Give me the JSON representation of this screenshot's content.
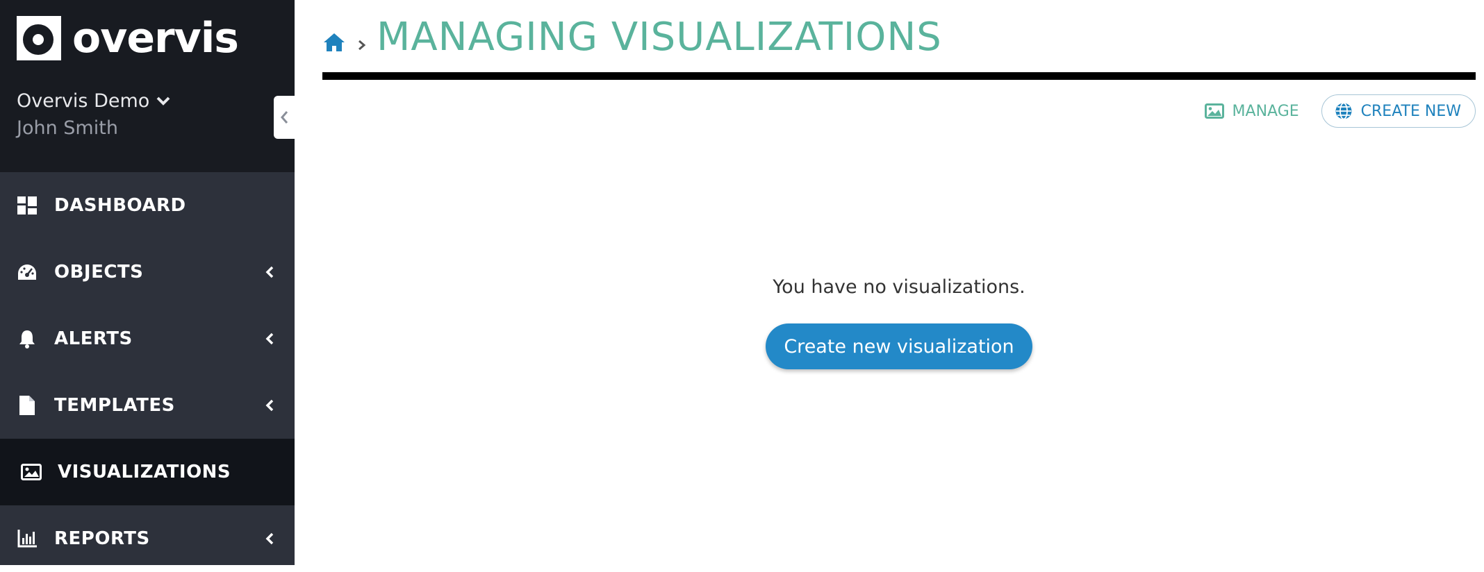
{
  "brand": {
    "name": "overvis"
  },
  "account": {
    "org": "Overvis Demo",
    "user": "John Smith"
  },
  "nav": {
    "items": [
      {
        "label": "DASHBOARD",
        "icon": "dashboard-icon"
      },
      {
        "label": "OBJECTS",
        "icon": "gauge-icon"
      },
      {
        "label": "ALERTS",
        "icon": "bell-icon"
      },
      {
        "label": "TEMPLATES",
        "icon": "file-icon"
      },
      {
        "label": "VISUALIZATIONS",
        "icon": "image-icon",
        "active": true
      },
      {
        "label": "REPORTS",
        "icon": "bar-chart-icon"
      }
    ]
  },
  "page": {
    "title": "MANAGING VISUALIZATIONS"
  },
  "toolbar": {
    "manage_label": "MANAGE",
    "create_label": "CREATE NEW"
  },
  "empty": {
    "message": "You have no visualizations.",
    "button_label": "Create new visualization"
  },
  "colors": {
    "sidebar": "#2d313b",
    "sidebar_top": "#181b21",
    "active": "#11141a",
    "accent_green": "#5ab39c",
    "accent_blue": "#2389c8"
  }
}
